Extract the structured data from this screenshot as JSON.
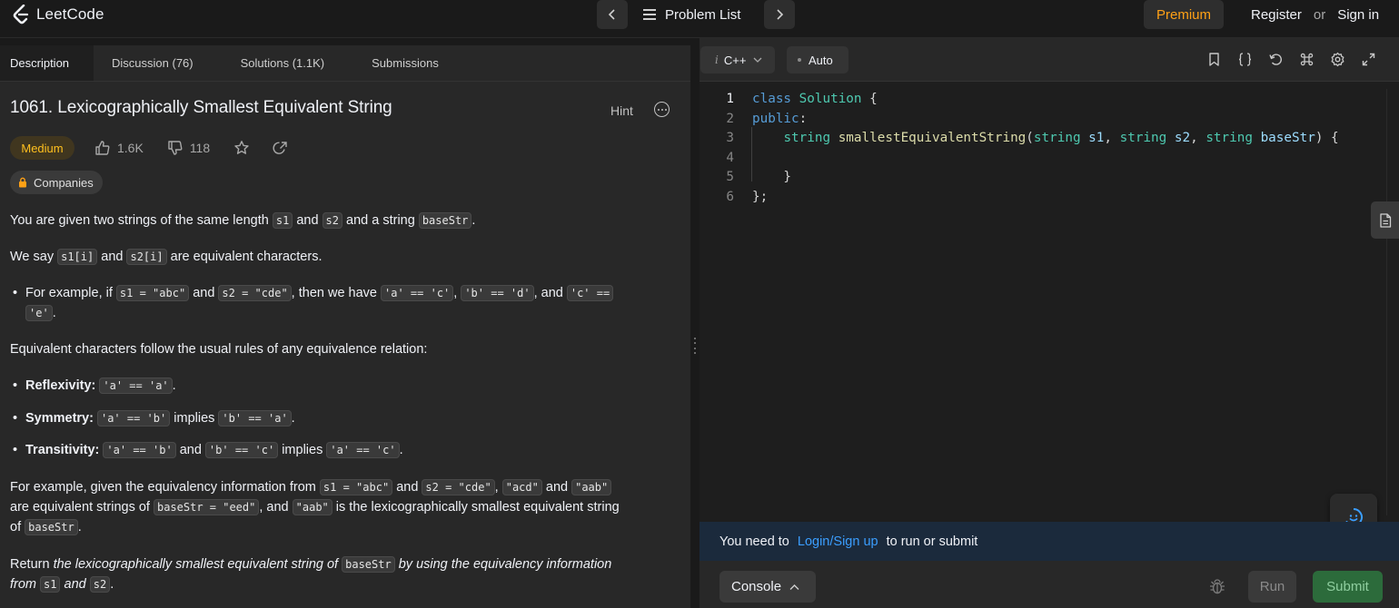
{
  "header": {
    "logo_text": "LeetCode",
    "problem_list_label": "Problem List",
    "premium_label": "Premium",
    "register_label": "Register",
    "or_label": "or",
    "signin_label": "Sign in"
  },
  "tabs": [
    {
      "label": "Description"
    },
    {
      "label": "Discussion (76)"
    },
    {
      "label": "Solutions (1.1K)"
    },
    {
      "label": "Submissions"
    }
  ],
  "problem": {
    "title": "1061. Lexicographically Smallest Equivalent String",
    "hint_label": "Hint",
    "difficulty": "Medium",
    "likes": "1.6K",
    "dislikes": "118",
    "companies_label": "Companies"
  },
  "description": {
    "p1": {
      "t1": "You are given two strings of the same length ",
      "c1": "s1",
      "t2": " and ",
      "c2": "s2",
      "t3": " and a string ",
      "c3": "baseStr",
      "t4": "."
    },
    "p2": {
      "t1": "We say ",
      "c1": "s1[i]",
      "t2": " and ",
      "c2": "s2[i]",
      "t3": " are equivalent characters."
    },
    "ex": {
      "t1": "For example, if ",
      "c1": "s1 = \"abc\"",
      "t2": " and ",
      "c2": "s2 = \"cde\"",
      "t3": ", then we have ",
      "c3": "'a' == 'c'",
      "t4": ", ",
      "c4": "'b' == 'd'",
      "t5": ", and ",
      "c5": "'c' ==",
      "c6": "'e'",
      "t6": "."
    },
    "p3": "Equivalent characters follow the usual rules of any equivalence relation:",
    "refl": {
      "b": "Reflexivity:",
      "c1": "'a' == 'a'",
      "t1": "."
    },
    "sym": {
      "b": "Symmetry:",
      "c1": "'a' == 'b'",
      "t1": " implies ",
      "c2": "'b' == 'a'",
      "t2": "."
    },
    "trans": {
      "b": "Transitivity:",
      "c1": "'a' == 'b'",
      "t1": " and ",
      "c2": "'b' == 'c'",
      "t2": " implies ",
      "c3": "'a' == 'c'",
      "t3": "."
    },
    "p4": {
      "t1": "For example, given the equivalency information from ",
      "c1": "s1 = \"abc\"",
      "t2": " and ",
      "c2": "s2 = \"cde\"",
      "t3": ", ",
      "c3": "\"acd\"",
      "t4": " and ",
      "c4": "\"aab\"",
      "t5": "are equivalent strings of ",
      "c5": "baseStr = \"eed\"",
      "t6": ", and ",
      "c6": "\"aab\"",
      "t7": " is the lexicographically smallest equivalent string",
      "t8": "of ",
      "c7": "baseStr",
      "t9": "."
    },
    "p5": {
      "t1": "Return ",
      "e1": "the lexicographically smallest equivalent string of ",
      "c1": "baseStr",
      "e2": " by using the equivalency information",
      "e3": "from ",
      "c2": "s1",
      "e4": " and ",
      "c3": "s2",
      "t2": "."
    }
  },
  "editor": {
    "language": "C++",
    "language_icon": "i",
    "mode": "Auto",
    "lines": [
      {
        "n": "1",
        "tokens": [
          {
            "k": "kw",
            "t": "class"
          },
          {
            "k": "pl",
            "t": " "
          },
          {
            "k": "ty",
            "t": "Solution"
          },
          {
            "k": "pl",
            "t": " {"
          }
        ]
      },
      {
        "n": "2",
        "tokens": [
          {
            "k": "kw",
            "t": "public"
          },
          {
            "k": "pl",
            "t": ":"
          }
        ]
      },
      {
        "n": "3",
        "tokens": [
          {
            "k": "pl",
            "t": "    "
          },
          {
            "k": "ty",
            "t": "string"
          },
          {
            "k": "pl",
            "t": " "
          },
          {
            "k": "fn",
            "t": "smallestEquivalentString"
          },
          {
            "k": "pl",
            "t": "("
          },
          {
            "k": "ty",
            "t": "string"
          },
          {
            "k": "pl",
            "t": " "
          },
          {
            "k": "pm",
            "t": "s1"
          },
          {
            "k": "pl",
            "t": ", "
          },
          {
            "k": "ty",
            "t": "string"
          },
          {
            "k": "pl",
            "t": " "
          },
          {
            "k": "pm",
            "t": "s2"
          },
          {
            "k": "pl",
            "t": ", "
          },
          {
            "k": "ty",
            "t": "string"
          },
          {
            "k": "pl",
            "t": " "
          },
          {
            "k": "pm",
            "t": "baseStr"
          },
          {
            "k": "pl",
            "t": ") {"
          }
        ]
      },
      {
        "n": "4",
        "tokens": []
      },
      {
        "n": "5",
        "tokens": [
          {
            "k": "pl",
            "t": "    }"
          }
        ]
      },
      {
        "n": "6",
        "tokens": [
          {
            "k": "pl",
            "t": "};"
          }
        ]
      }
    ]
  },
  "login_bar": {
    "t1": "You need to",
    "link": "Login/Sign up",
    "t2": "to run or submit"
  },
  "bottom": {
    "console_label": "Console",
    "run_label": "Run",
    "submit_label": "Submit"
  },
  "colors": {
    "accent": "#ffa116",
    "medium": "#ffc01e",
    "link": "#3b9eff",
    "submit_bg": "#2c6b3b"
  }
}
